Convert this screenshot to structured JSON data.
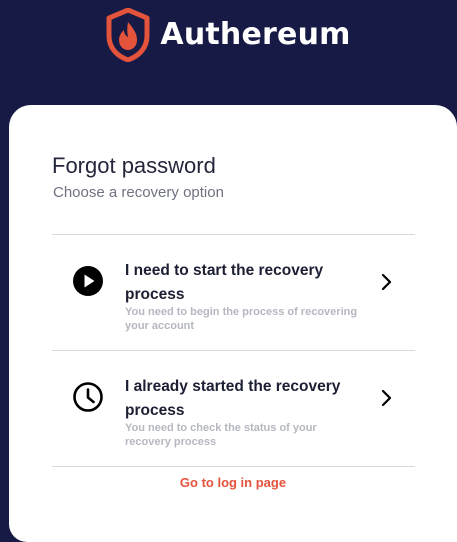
{
  "header": {
    "brand_name": "Authereum",
    "logo_icon": "shield-flame-icon",
    "background_color": "#161a45",
    "logo_color": "#e4533b"
  },
  "card": {
    "title": "Forgot password",
    "subtitle": "Choose a recovery option",
    "options": [
      {
        "title": "I need to start the recovery process",
        "description": "You need to begin the process of recovering your account",
        "icon": "play-circle-icon",
        "chevron": "chevron-right-icon"
      },
      {
        "title": "I already started the recovery process",
        "description": "You need to check the status of your recovery process",
        "icon": "clock-icon",
        "chevron": "chevron-right-icon"
      }
    ],
    "login_link": "Go to log in page",
    "accent_color": "#e4533b"
  }
}
